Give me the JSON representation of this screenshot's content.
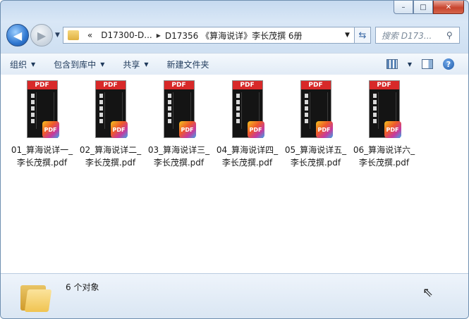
{
  "window": {
    "caption_buttons": {
      "minimize": "–",
      "maximize": "□",
      "close": "✕"
    }
  },
  "nav": {
    "back_icon": "back-arrow-icon",
    "forward_icon": "forward-arrow-icon",
    "breadcrumb_overflow": "«",
    "breadcrumbs": [
      "D17300-D...",
      "D17356 《算海说详》李长茂撰 6册"
    ],
    "search_placeholder": "搜索 D173..."
  },
  "toolbar": {
    "organize": "组织",
    "include_in_library": "包含到库中",
    "share": "共享",
    "new_folder": "新建文件夹"
  },
  "files": [
    {
      "line1": "01_算海说详一_",
      "line2": "李长茂撰.pdf",
      "cover_label": "PDF",
      "badge": "PDF"
    },
    {
      "line1": "02_算海说详二_",
      "line2": "李长茂撰.pdf",
      "cover_label": "PDF",
      "badge": "PDF"
    },
    {
      "line1": "03_算海说详三_",
      "line2": "李长茂撰.pdf",
      "cover_label": "PDF",
      "badge": "PDF"
    },
    {
      "line1": "04_算海说详四_",
      "line2": "李长茂撰.pdf",
      "cover_label": "PDF",
      "badge": "PDF"
    },
    {
      "line1": "05_算海说详五_",
      "line2": "李长茂撰.pdf",
      "cover_label": "PDF",
      "badge": "PDF"
    },
    {
      "line1": "06_算海说详六_",
      "line2": "李长茂撰.pdf",
      "cover_label": "PDF",
      "badge": "PDF"
    }
  ],
  "status": {
    "item_count": "6 个对象"
  }
}
